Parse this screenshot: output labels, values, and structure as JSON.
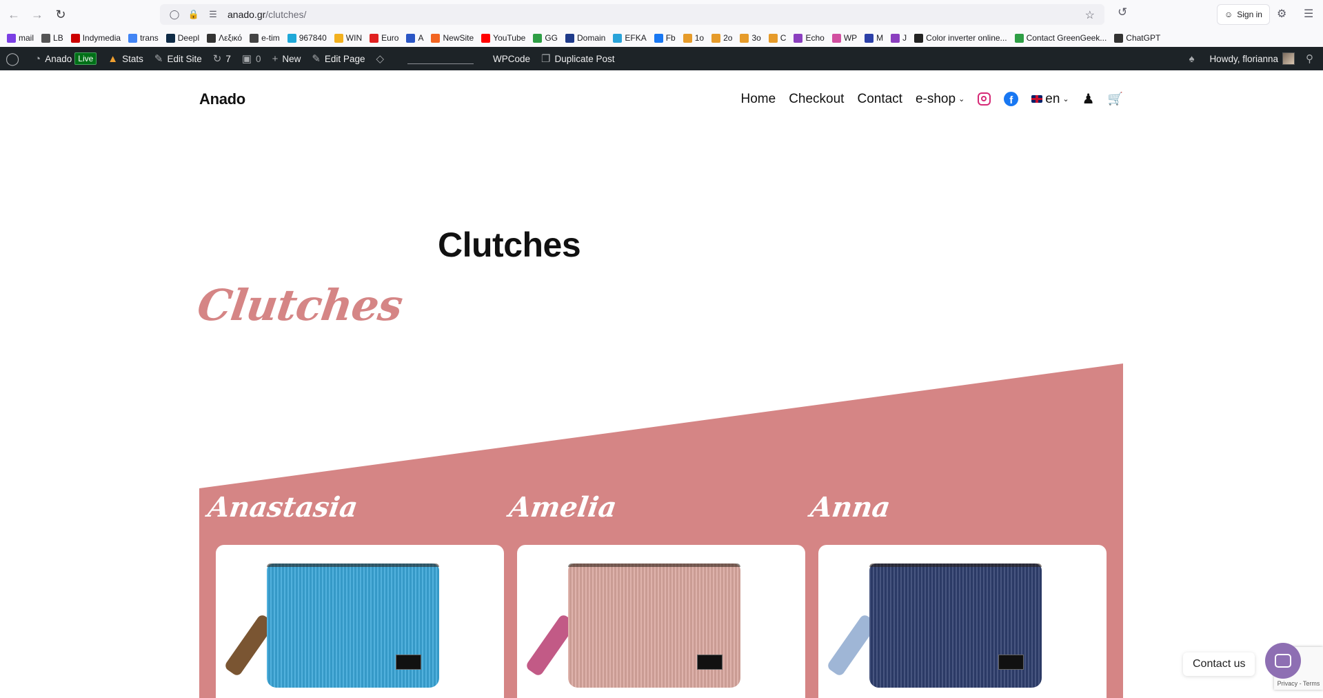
{
  "browser": {
    "url_domain": "anado.gr",
    "url_path": "/clutches/",
    "signin_label": "Sign in"
  },
  "bookmarks": [
    {
      "label": "mail",
      "color": "#7b3fe4"
    },
    {
      "label": "LB",
      "color": "#555555"
    },
    {
      "label": "Indymedia",
      "color": "#cc0000"
    },
    {
      "label": "trans",
      "color": "#4285f4"
    },
    {
      "label": "Deepl",
      "color": "#0f2b46"
    },
    {
      "label": "Λεξικό",
      "color": "#333333"
    },
    {
      "label": "e-tim",
      "color": "#444444"
    },
    {
      "label": "967840",
      "color": "#1fa8d8"
    },
    {
      "label": "WIN",
      "color": "#f2b01e"
    },
    {
      "label": "Euro",
      "color": "#e02020"
    },
    {
      "label": "A",
      "color": "#2b56c5"
    },
    {
      "label": "NewSite",
      "color": "#f26522"
    },
    {
      "label": "YouTube",
      "color": "#ff0000"
    },
    {
      "label": "GG",
      "color": "#2e9e45"
    },
    {
      "label": "Domain",
      "color": "#1e3a8a"
    },
    {
      "label": "EFKA",
      "color": "#29a3d9"
    },
    {
      "label": "Fb",
      "color": "#1877f2"
    },
    {
      "label": "1o",
      "color": "#e69b2a"
    },
    {
      "label": "2o",
      "color": "#e69b2a"
    },
    {
      "label": "3o",
      "color": "#e69b2a"
    },
    {
      "label": "C",
      "color": "#e69b2a"
    },
    {
      "label": "Echo",
      "color": "#8b3fbf"
    },
    {
      "label": "WP",
      "color": "#d14fa0"
    },
    {
      "label": "M",
      "color": "#2b3fa8"
    },
    {
      "label": "J",
      "color": "#8b3fbf"
    },
    {
      "label": "Color inverter online...",
      "color": "#222222"
    },
    {
      "label": "Contact GreenGeek...",
      "color": "#2e9e45"
    },
    {
      "label": "ChatGPT",
      "color": "#333333"
    }
  ],
  "adminbar": {
    "site_name": "Anado",
    "live_label": "Live",
    "stats_label": "Stats",
    "edit_site_label": "Edit Site",
    "updates_count": "7",
    "comments_count": "0",
    "new_label": "New",
    "edit_page_label": "Edit Page",
    "wpcode_label": "WPCode",
    "duplicate_label": "Duplicate Post",
    "howdy_label": "Howdy, florianna"
  },
  "site": {
    "title": "Anado",
    "nav": {
      "home": "Home",
      "checkout": "Checkout",
      "contact": "Contact",
      "eshop": "e-shop",
      "lang": "en"
    },
    "facebook_glyph": "f"
  },
  "page": {
    "title": "Clutches",
    "script_title": "Clutches"
  },
  "products": [
    {
      "name": "Anastasia",
      "bag_color": "#3aa6d8",
      "strap_color": "#7a5532"
    },
    {
      "name": "Amelia",
      "bag_color": "#dba9a0",
      "strap_color": "#c25a86"
    },
    {
      "name": "Anna",
      "bag_color": "#2f3f6e",
      "strap_color": "#9fb6d6"
    }
  ],
  "widgets": {
    "contact_us": "Contact us",
    "recaptcha": "Privacy - Terms"
  },
  "colors": {
    "accent_pink": "#d58585",
    "admin_bar": "#1d2327"
  }
}
